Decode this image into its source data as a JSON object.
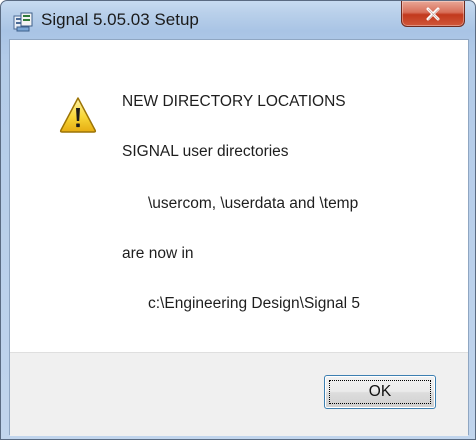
{
  "window": {
    "title": "Signal 5.05.03 Setup",
    "app_icon": "installer-icon",
    "close_icon": "close-icon"
  },
  "message": {
    "icon": "warning-icon",
    "lines": [
      "NEW DIRECTORY LOCATIONS",
      "SIGNAL user directories",
      "\\usercom, \\userdata and \\temp",
      "are now in",
      "c:\\Engineering Design\\Signal 5"
    ]
  },
  "buttons": {
    "ok_label": "OK"
  },
  "colors": {
    "close_red": "#c2391d",
    "title_bar": "#b9d0ea",
    "footer": "#f0f0f0",
    "button_border_focus": "#3c7fb1"
  }
}
